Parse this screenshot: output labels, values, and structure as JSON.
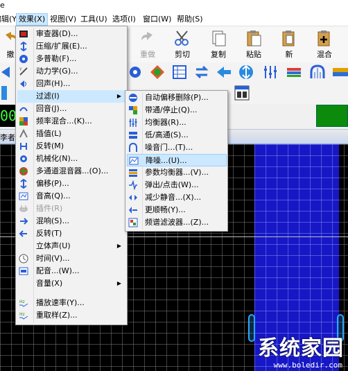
{
  "title_fragment": "e",
  "menubar": {
    "items": [
      {
        "id": "edit",
        "label": "编辑(Y)"
      },
      {
        "id": "effects",
        "label": "效果(X)"
      },
      {
        "id": "view",
        "label": "视图(V)"
      },
      {
        "id": "tools",
        "label": "工具(U)"
      },
      {
        "id": "options",
        "label": "选项(I)"
      },
      {
        "id": "window",
        "label": "窗口(W)"
      },
      {
        "id": "help",
        "label": "帮助(S)"
      }
    ]
  },
  "toolbar": {
    "buttons": [
      {
        "id": "undo",
        "label": "撤",
        "icon": "undo-icon"
      },
      {
        "id": "redo",
        "label": "重做",
        "icon": "redo-icon",
        "disabled": true
      },
      {
        "id": "cut",
        "label": "剪切",
        "icon": "scissors-icon"
      },
      {
        "id": "copy",
        "label": "复制",
        "icon": "copy-icon"
      },
      {
        "id": "paste",
        "label": "粘贴",
        "icon": "paste-icon"
      },
      {
        "id": "new",
        "label": "新",
        "icon": "new-file-icon"
      },
      {
        "id": "mix",
        "label": "混合",
        "icon": "mix-paste-icon"
      }
    ]
  },
  "time_display": "00",
  "tab_label": "李者",
  "effects_menu": {
    "items": [
      {
        "label": "审查器(D)...",
        "icon": "inspector-icon",
        "color": "#cc2222"
      },
      {
        "label": "压缩/扩展(E)...",
        "icon": "compress-icon",
        "color": "#2a5fd6"
      },
      {
        "label": "多普勒(F)...",
        "icon": "doppler-icon",
        "color": "#2a5fd6"
      },
      {
        "label": "动力学(G)...",
        "icon": "dynamics-icon",
        "color": "#555555"
      },
      {
        "label": "回声(H)...",
        "icon": "echo-icon",
        "color": "#2a5fd6"
      },
      {
        "label": "过滤(I)",
        "icon": "filter-icon",
        "submenu": true,
        "highlight": true
      },
      {
        "label": "回音(J)...",
        "icon": "reverb-icon",
        "color": "#2a5fd6"
      },
      {
        "label": "频率混合...(K)...",
        "icon": "freq-mix-icon",
        "color": "#e0a000"
      },
      {
        "label": "插值(L)",
        "icon": "interpolate-icon",
        "color": "#7a7a7a"
      },
      {
        "label": "反转(M)",
        "icon": "invert-icon",
        "color": "#2a5fd6"
      },
      {
        "label": "机械化(N)...",
        "icon": "mechanize-icon",
        "color": "#2a5fd6"
      },
      {
        "label": "多通道混音器...(O)...",
        "icon": "multichannel-icon",
        "color": "#d63c2a"
      },
      {
        "label": "偏移(P)...",
        "icon": "offset-icon",
        "color": "#2a5fd6"
      },
      {
        "label": "音高(Q)...",
        "icon": "pitch-icon",
        "color": "#2a5fd6"
      },
      {
        "label": "插件(R)",
        "icon": "plugin-icon",
        "disabled": true
      },
      {
        "label": "混响(S)...",
        "icon": "reverb2-icon",
        "color": "#2a5fd6"
      },
      {
        "label": "反转(T)",
        "icon": "reverse-icon",
        "color": "#2a5fd6"
      },
      {
        "label": "立体声(U)",
        "submenu": true
      },
      {
        "label": "时间(V)...",
        "icon": "clock-icon",
        "color": "#555555"
      },
      {
        "label": "配音...(W)...",
        "icon": "voiceover-icon",
        "color": "#2a5fd6"
      },
      {
        "label": "音量(X)",
        "submenu": true
      },
      {
        "label": "播放速率(Y)...",
        "icon": "hz-icon",
        "color": "#2a8a2a"
      },
      {
        "label": "重取样(Z)...",
        "icon": "hz-icon",
        "color": "#2a8a2a"
      }
    ]
  },
  "filter_menu": {
    "items": [
      {
        "label": "自动偏移删除(P)...",
        "icon": "auto-dc-icon",
        "color": "#2a5fd6"
      },
      {
        "label": "带通/停止(Q)...",
        "icon": "bandpass-icon",
        "color": "#2a5fd6"
      },
      {
        "label": "均衡器(R)...",
        "icon": "equalizer-icon",
        "color": "#2a5fd6"
      },
      {
        "label": "低/高通(S)...",
        "icon": "lowhigh-icon",
        "color": "#2a5fd6"
      },
      {
        "label": "噪音门...(T)...",
        "icon": "noisegate-icon",
        "color": "#2a5fd6"
      },
      {
        "label": "降噪...(U)...",
        "icon": "noise-reduction-icon",
        "color": "#2a5fd6",
        "highlight": true
      },
      {
        "label": "参数均衡器...(V)...",
        "icon": "parametric-eq-icon",
        "color": "#e0a000"
      },
      {
        "label": "弹出/点击(W)...",
        "icon": "pop-click-icon",
        "color": "#2a5fd6"
      },
      {
        "label": "减少静音...(X)...",
        "icon": "reduce-silence-icon",
        "color": "#2a5fd6"
      },
      {
        "label": "更顺畅(Y)...",
        "icon": "smooth-icon",
        "color": "#2a5fd6"
      },
      {
        "label": "频谱滤波器...(Z)...",
        "icon": "spectral-icon",
        "color": "#d63c2a"
      }
    ]
  },
  "watermark": {
    "text": "系统家园",
    "url": "www.boledir.com"
  }
}
